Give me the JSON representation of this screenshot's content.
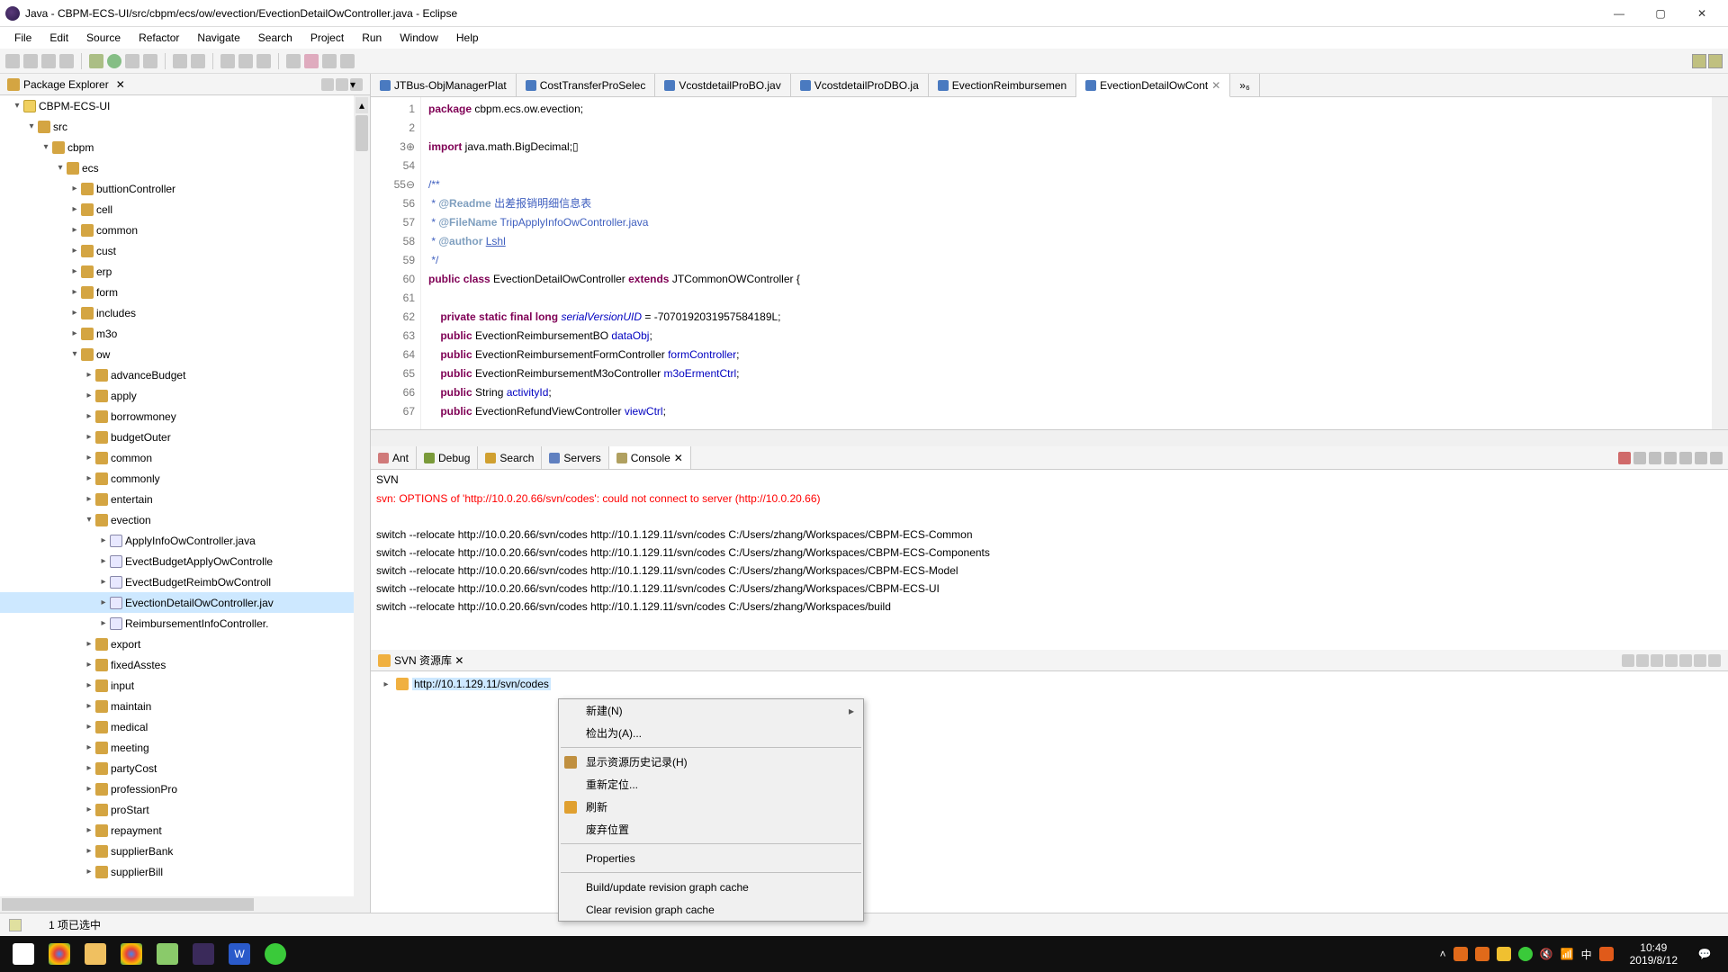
{
  "window": {
    "title": "Java - CBPM-ECS-UI/src/cbpm/ecs/ow/evection/EvectionDetailOwController.java - Eclipse"
  },
  "menus": [
    "File",
    "Edit",
    "Source",
    "Refactor",
    "Navigate",
    "Search",
    "Project",
    "Run",
    "Window",
    "Help"
  ],
  "package_explorer": {
    "title": "Package Explorer",
    "tree": [
      {
        "d": 0,
        "tw": "▾",
        "icon": "proj",
        "label": "CBPM-ECS-UI"
      },
      {
        "d": 1,
        "tw": "▾",
        "icon": "srcf",
        "label": "src"
      },
      {
        "d": 2,
        "tw": "▾",
        "icon": "pkg",
        "label": "cbpm"
      },
      {
        "d": 3,
        "tw": "▾",
        "icon": "pkg",
        "label": "ecs"
      },
      {
        "d": 4,
        "tw": "▸",
        "icon": "pkg",
        "label": "buttionController"
      },
      {
        "d": 4,
        "tw": "▸",
        "icon": "pkg",
        "label": "cell"
      },
      {
        "d": 4,
        "tw": "▸",
        "icon": "pkg",
        "label": "common"
      },
      {
        "d": 4,
        "tw": "▸",
        "icon": "pkg",
        "label": "cust"
      },
      {
        "d": 4,
        "tw": "▸",
        "icon": "pkg",
        "label": "erp"
      },
      {
        "d": 4,
        "tw": "▸",
        "icon": "pkg",
        "label": "form"
      },
      {
        "d": 4,
        "tw": "▸",
        "icon": "pkg",
        "label": "includes"
      },
      {
        "d": 4,
        "tw": "▸",
        "icon": "pkg",
        "label": "m3o"
      },
      {
        "d": 4,
        "tw": "▾",
        "icon": "pkg",
        "label": "ow"
      },
      {
        "d": 5,
        "tw": "▸",
        "icon": "pkg",
        "label": "advanceBudget"
      },
      {
        "d": 5,
        "tw": "▸",
        "icon": "pkg",
        "label": "apply"
      },
      {
        "d": 5,
        "tw": "▸",
        "icon": "pkg",
        "label": "borrowmoney"
      },
      {
        "d": 5,
        "tw": "▸",
        "icon": "pkg",
        "label": "budgetOuter"
      },
      {
        "d": 5,
        "tw": "▸",
        "icon": "pkg",
        "label": "common"
      },
      {
        "d": 5,
        "tw": "▸",
        "icon": "pkg",
        "label": "commonly"
      },
      {
        "d": 5,
        "tw": "▸",
        "icon": "pkg",
        "label": "entertain"
      },
      {
        "d": 5,
        "tw": "▾",
        "icon": "pkg",
        "label": "evection"
      },
      {
        "d": 6,
        "tw": "▸",
        "icon": "java",
        "label": "ApplyInfoOwController.java"
      },
      {
        "d": 6,
        "tw": "▸",
        "icon": "java",
        "label": "EvectBudgetApplyOwControlle"
      },
      {
        "d": 6,
        "tw": "▸",
        "icon": "java",
        "label": "EvectBudgetReimbOwControll"
      },
      {
        "d": 6,
        "tw": "▸",
        "icon": "java",
        "label": "EvectionDetailOwController.jav",
        "sel": true
      },
      {
        "d": 6,
        "tw": "▸",
        "icon": "java",
        "label": "ReimbursementInfoController."
      },
      {
        "d": 5,
        "tw": "▸",
        "icon": "pkg",
        "label": "export"
      },
      {
        "d": 5,
        "tw": "▸",
        "icon": "pkg",
        "label": "fixedAsstes"
      },
      {
        "d": 5,
        "tw": "▸",
        "icon": "pkg",
        "label": "input"
      },
      {
        "d": 5,
        "tw": "▸",
        "icon": "pkg",
        "label": "maintain"
      },
      {
        "d": 5,
        "tw": "▸",
        "icon": "pkg",
        "label": "medical"
      },
      {
        "d": 5,
        "tw": "▸",
        "icon": "pkg",
        "label": "meeting"
      },
      {
        "d": 5,
        "tw": "▸",
        "icon": "pkg",
        "label": "partyCost"
      },
      {
        "d": 5,
        "tw": "▸",
        "icon": "pkg",
        "label": "professionPro"
      },
      {
        "d": 5,
        "tw": "▸",
        "icon": "pkg",
        "label": "proStart"
      },
      {
        "d": 5,
        "tw": "▸",
        "icon": "pkg",
        "label": "repayment"
      },
      {
        "d": 5,
        "tw": "▸",
        "icon": "pkg",
        "label": "supplierBank"
      },
      {
        "d": 5,
        "tw": "▸",
        "icon": "pkg",
        "label": "supplierBill"
      }
    ]
  },
  "editor_tabs": [
    {
      "label": "JTBus-ObjManagerPlat"
    },
    {
      "label": "CostTransferProSelec"
    },
    {
      "label": "VcostdetailProBO.jav"
    },
    {
      "label": "VcostdetailProDBO.ja"
    },
    {
      "label": "EvectionReimbursemen"
    },
    {
      "label": "EvectionDetailOwCont",
      "active": true
    }
  ],
  "code_lines": [
    {
      "n": "1",
      "t": "package",
      "body": "<span class='kw'>package</span> cbpm.ecs.ow.evection;"
    },
    {
      "n": "2",
      "body": ""
    },
    {
      "n": "3⊕",
      "body": "<span class='kw'>import</span> java.math.BigDecimal;▯"
    },
    {
      "n": "54",
      "body": ""
    },
    {
      "n": "55⊖",
      "body": "<span class='cm'>/**</span>"
    },
    {
      "n": "56",
      "body": "<span class='cm'> * <span class='cmtag'>@Readme</span> 出差报销明细信息表</span>"
    },
    {
      "n": "57",
      "body": "<span class='cm'> * <span class='cmtag'>@FileName</span> TripApplyInfoOwController.java</span>"
    },
    {
      "n": "58",
      "body": "<span class='cm'> * <span class='cmtag'>@author</span> <span class='ul'>Lshl</span></span>"
    },
    {
      "n": "59",
      "body": "<span class='cm'> */</span>"
    },
    {
      "n": "60",
      "body": "<span class='kw'>public</span> <span class='kw'>class</span> EvectionDetailOwController <span class='kw'>extends</span> JTCommonOWController {"
    },
    {
      "n": "61",
      "body": ""
    },
    {
      "n": "62",
      "body": "    <span class='kw'>private</span> <span class='kw'>static</span> <span class='kw'>final</span> <span class='kw'>long</span> <span class='fld' style='font-style:italic'>serialVersionUID</span> = -7070192031957584189L;"
    },
    {
      "n": "63",
      "body": "    <span class='kw'>public</span> EvectionReimbursementBO <span class='fld'>dataObj</span>;"
    },
    {
      "n": "64",
      "body": "    <span class='kw'>public</span> EvectionReimbursementFormController <span class='fld'>formController</span>;"
    },
    {
      "n": "65",
      "body": "    <span class='kw'>public</span> EvectionReimbursementM3oController <span class='fld'>m3oErmentCtrl</span>;"
    },
    {
      "n": "66",
      "body": "    <span class='kw'>public</span> String <span class='fld'>activityId</span>;"
    },
    {
      "n": "67",
      "body": "    <span class='kw'>public</span> EvectionRefundViewController <span class='fld'>viewCtrl</span>;"
    }
  ],
  "bottom_tabs": {
    "tabs": [
      {
        "label": "Ant",
        "color": "#d07a7a"
      },
      {
        "label": "Debug",
        "color": "#7a9a3a"
      },
      {
        "label": "Search",
        "color": "#d0a030"
      },
      {
        "label": "Servers",
        "color": "#6080c0"
      },
      {
        "label": "Console",
        "color": "#b0a060",
        "active": true
      }
    ]
  },
  "console": {
    "header": "SVN",
    "err": "svn: OPTIONS of 'http://10.0.20.66/svn/codes': could not connect to server (http://10.0.20.66)",
    "lines": [
      "switch --relocate http://10.0.20.66/svn/codes http://10.1.129.11/svn/codes C:/Users/zhang/Workspaces/CBPM-ECS-Common",
      "switch --relocate http://10.0.20.66/svn/codes http://10.1.129.11/svn/codes C:/Users/zhang/Workspaces/CBPM-ECS-Components",
      "switch --relocate http://10.0.20.66/svn/codes http://10.1.129.11/svn/codes C:/Users/zhang/Workspaces/CBPM-ECS-Model",
      "switch --relocate http://10.0.20.66/svn/codes http://10.1.129.11/svn/codes C:/Users/zhang/Workspaces/CBPM-ECS-UI",
      "switch --relocate http://10.0.20.66/svn/codes http://10.1.129.11/svn/codes C:/Users/zhang/Workspaces/build"
    ]
  },
  "svn_panel": {
    "tab": "SVN 资源库",
    "url": "http://10.1.129.11/svn/codes"
  },
  "ctxmenu": [
    {
      "label": "新建(N)",
      "arrow": true
    },
    {
      "label": "检出为(A)..."
    },
    {
      "sep": true
    },
    {
      "label": "显示资源历史记录(H)",
      "icon": "#c09040"
    },
    {
      "label": "重新定位..."
    },
    {
      "label": "刷新",
      "icon": "#e0a030"
    },
    {
      "label": "废弃位置"
    },
    {
      "sep": true
    },
    {
      "label": "Properties"
    },
    {
      "sep": true
    },
    {
      "label": "Build/update revision graph cache"
    },
    {
      "label": "Clear revision graph cache"
    }
  ],
  "status": {
    "text": "1 项已选中"
  },
  "clock": {
    "time": "10:49",
    "date": "2019/8/12"
  }
}
